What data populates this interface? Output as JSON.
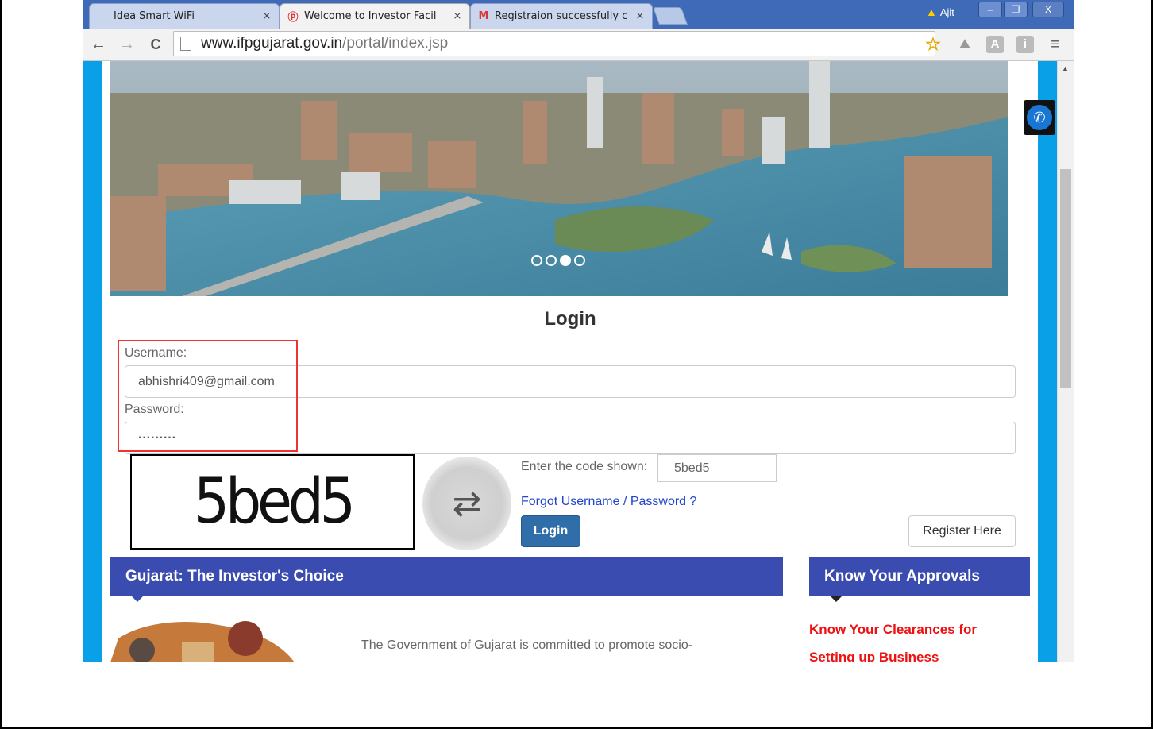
{
  "tabs": [
    {
      "title": "Idea Smart WiFi",
      "icon": "blank",
      "close": "×"
    },
    {
      "title": "Welcome to Investor Facil",
      "icon": "ifp-logo",
      "close": "×"
    },
    {
      "title": "Registraion successfully c",
      "icon": "gmail-m",
      "close": "×"
    }
  ],
  "profile": {
    "name": "Ajit",
    "warning_icon": "▲"
  },
  "window_controls": {
    "minimize": "–",
    "restore": "❐",
    "close": "X"
  },
  "toolbar": {
    "back_icon": "←",
    "forward_icon": "→",
    "reload_icon": "C",
    "url_host": "www.ifpgujarat.gov.in",
    "url_path": "/portal/index.jsp",
    "star_icon": "☆",
    "ext1_icon": "⛰",
    "ext2_label": "A",
    "ext3_label": "i",
    "menu_icon": "≡"
  },
  "carousel": {
    "slides": 4,
    "active_index": 2
  },
  "login": {
    "title": "Login",
    "username_label": "Username:",
    "username_value": "abhishri409@gmail.com",
    "password_label": "Password:",
    "password_value": "·········",
    "captcha_text": "5bed5",
    "code_label": "Enter the code shown:",
    "code_value": "5bed5",
    "forgot_link": "Forgot Username / Password ?",
    "login_button": "Login",
    "register_button": "Register Here"
  },
  "panels": {
    "left_title": "Gujarat: The Investor's Choice",
    "left_text": "The Government of Gujarat is committed to promote socio-",
    "right_title": "Know Your Approvals",
    "right_link": "Know Your Clearances for Setting up Business"
  },
  "colors": {
    "site_blue": "#0aa0e8",
    "panel_header": "#3b4cb0",
    "login_button": "#2f6ea8",
    "link_red": "#ee1111",
    "highlight": "#e33333"
  }
}
